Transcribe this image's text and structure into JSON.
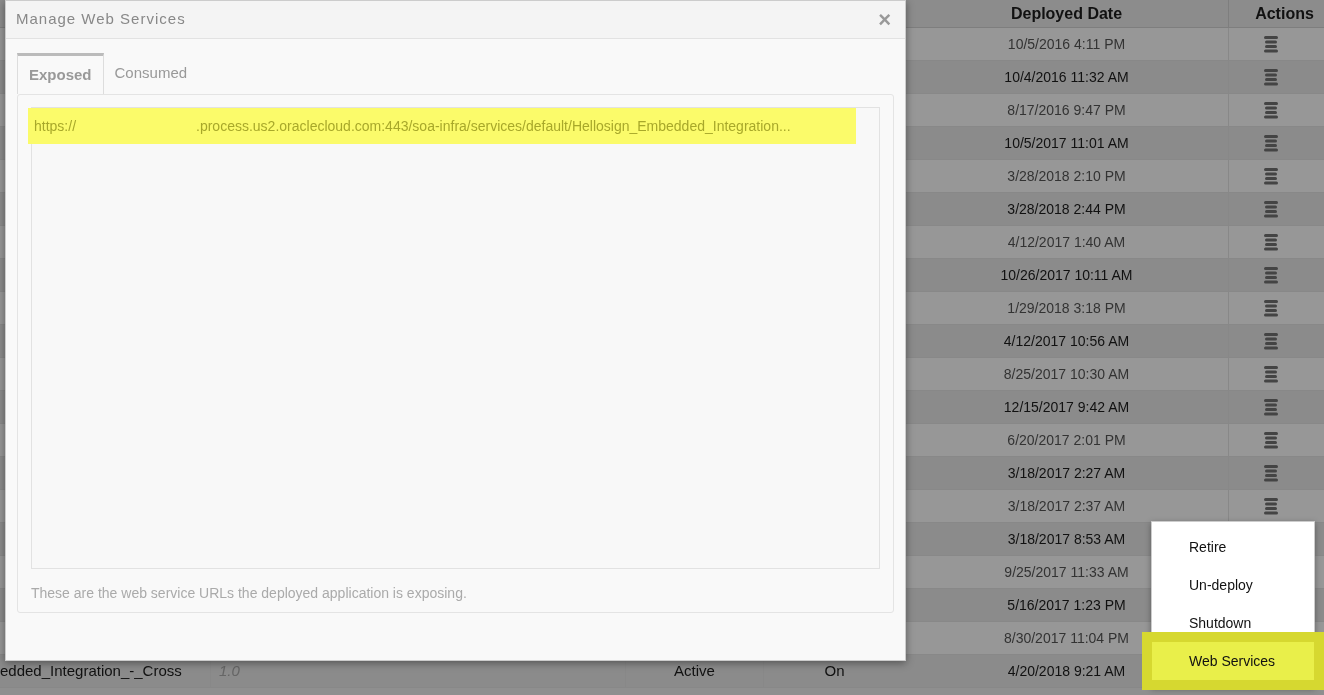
{
  "table": {
    "columns": [
      {
        "label": "Deployed Date"
      },
      {
        "label": "Actions"
      }
    ],
    "rows": [
      {
        "deployed_date": "10/5/2016 4:11 PM",
        "actions_menu": true
      },
      {
        "deployed_date": "10/4/2016 11:32 AM",
        "actions_menu": true
      },
      {
        "deployed_date": "8/17/2016 9:47 PM",
        "actions_menu": true
      },
      {
        "deployed_date": "10/5/2017 11:01 AM",
        "actions_menu": true
      },
      {
        "deployed_date": "3/28/2018 2:10 PM",
        "actions_menu": true
      },
      {
        "deployed_date": "3/28/2018 2:44 PM",
        "actions_menu": true
      },
      {
        "deployed_date": "4/12/2017 1:40 AM",
        "actions_menu": true
      },
      {
        "deployed_date": "10/26/2017 10:11 AM",
        "actions_menu": true
      },
      {
        "deployed_date": "1/29/2018 3:18 PM",
        "actions_menu": true
      },
      {
        "deployed_date": "4/12/2017 10:56 AM",
        "actions_menu": true
      },
      {
        "deployed_date": "8/25/2017 10:30 AM",
        "actions_menu": true
      },
      {
        "deployed_date": "12/15/2017 9:42 AM",
        "actions_menu": true
      },
      {
        "deployed_date": "6/20/2017 2:01 PM",
        "actions_menu": true
      },
      {
        "deployed_date": "3/18/2017 2:27 AM",
        "actions_menu": true
      },
      {
        "deployed_date": "3/18/2017 2:37 AM",
        "actions_menu": true
      },
      {
        "deployed_date": "3/18/2017 8:53 AM",
        "actions_menu": false
      },
      {
        "deployed_date": "9/25/2017 11:33 AM",
        "actions_menu": false
      },
      {
        "deployed_date": "5/16/2017 1:23 PM",
        "actions_menu": false
      },
      {
        "deployed_date": "8/30/2017 11:04 PM",
        "actions_menu": false
      },
      {
        "name": "edded_Integration_-_Cross",
        "version": "1.0",
        "status": "Active",
        "mode": "On",
        "deployed_date": "4/20/2018 9:21 AM",
        "actions_menu": false
      }
    ]
  },
  "dialog": {
    "title": "Manage Web Services",
    "close": "×",
    "tabs": [
      {
        "label": "Exposed",
        "selected": true
      },
      {
        "label": "Consumed",
        "selected": false
      }
    ],
    "urls": [
      {
        "prefix": "https://",
        "rest": ".process.us2.oraclecloud.com:443/soa-infra/services/default/Hellosign_Embedded_Integration...",
        "highlighted": true
      }
    ],
    "footer": "These are the web service URLs the deployed application is exposing."
  },
  "menu": {
    "items": [
      {
        "label": "Retire",
        "selected": false
      },
      {
        "label": "Un-deploy",
        "selected": false
      },
      {
        "label": "Shutdown",
        "selected": false
      },
      {
        "label": "Web Services",
        "selected": true
      }
    ]
  }
}
